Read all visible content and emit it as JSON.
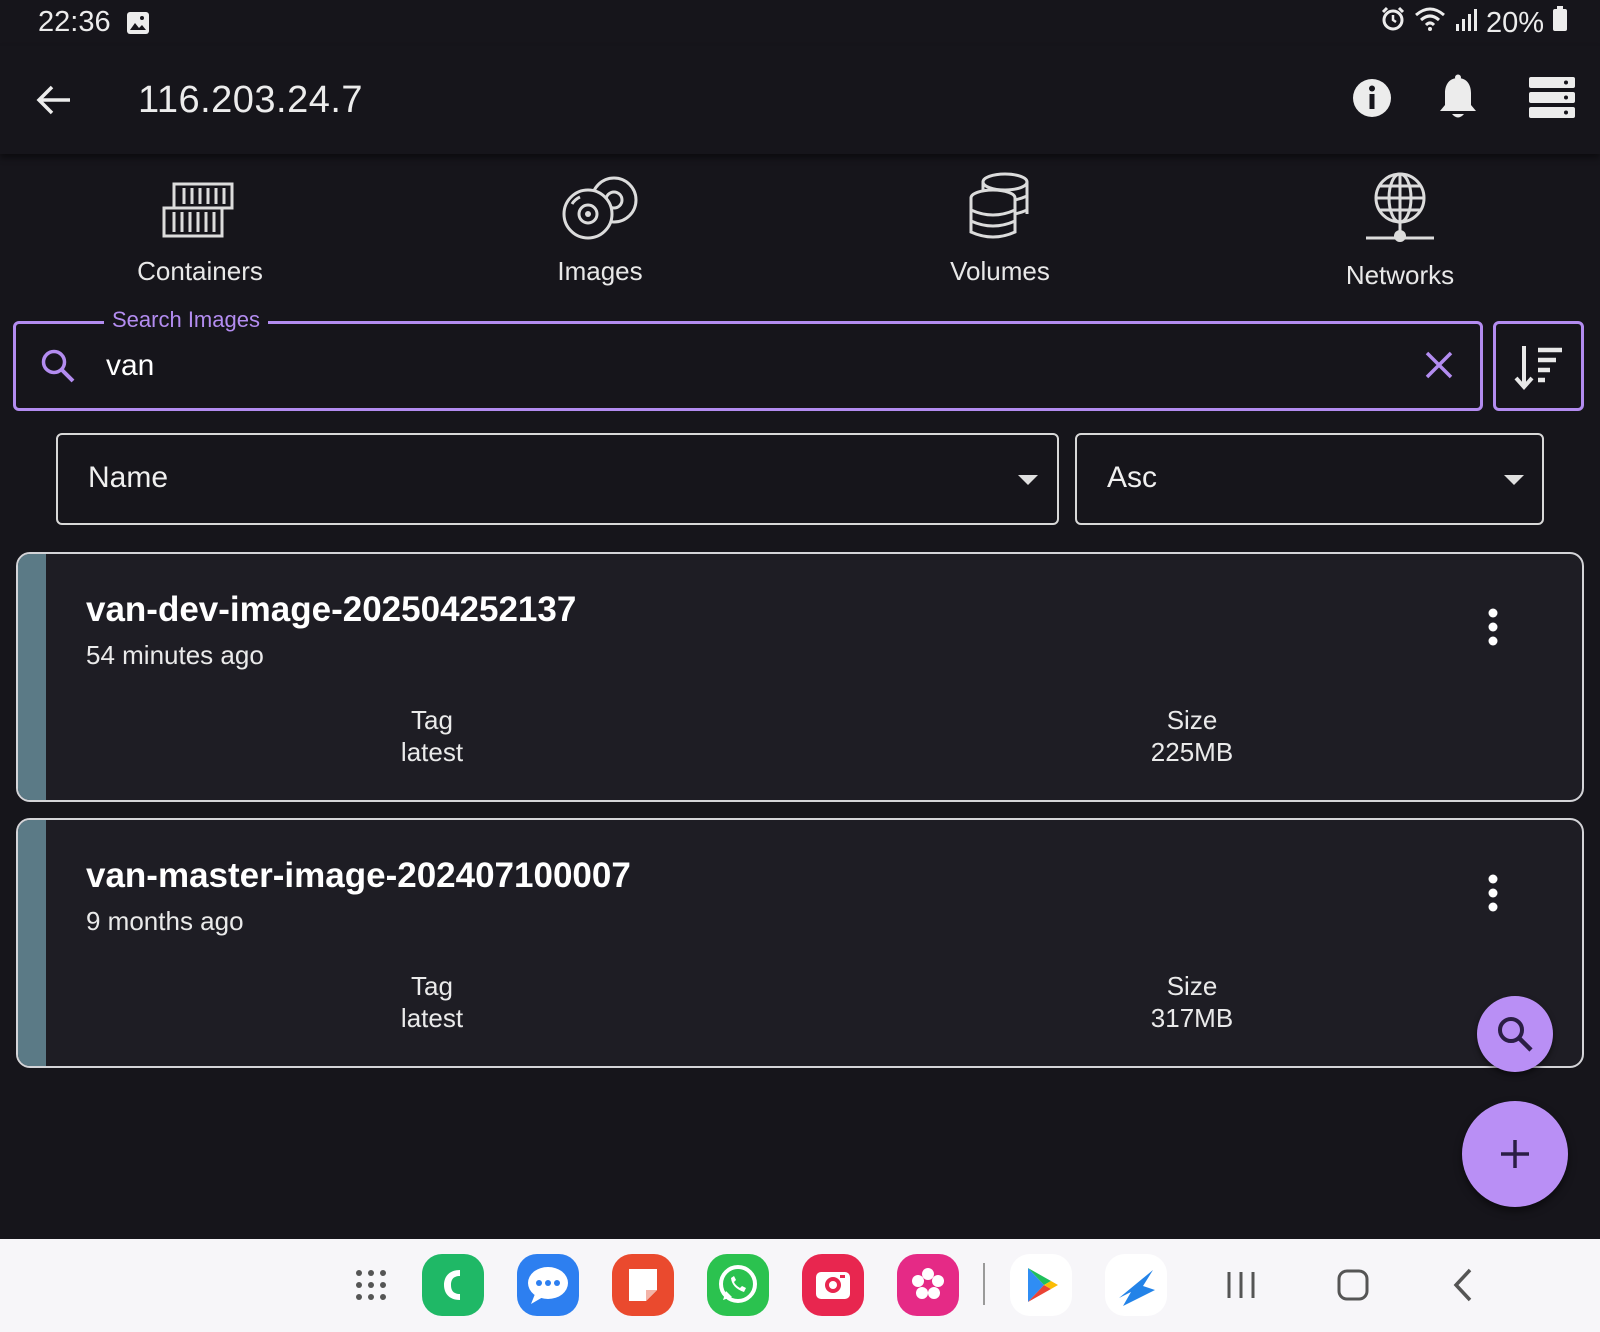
{
  "status_bar": {
    "time": "22:36",
    "battery": "20%",
    "icons": [
      "gallery-icon",
      "alarm-icon",
      "wifi-icon",
      "signal-icon",
      "battery-icon"
    ]
  },
  "app_bar": {
    "title": "116.203.24.7",
    "icons": [
      "back-arrow-icon",
      "info-icon",
      "bell-icon",
      "server-icon"
    ]
  },
  "tabs": [
    {
      "label": "Containers",
      "icon": "containers-icon"
    },
    {
      "label": "Images",
      "icon": "images-icon"
    },
    {
      "label": "Volumes",
      "icon": "volumes-icon"
    },
    {
      "label": "Networks",
      "icon": "networks-icon"
    }
  ],
  "search": {
    "legend": "Search Images",
    "value": "van"
  },
  "sort": {
    "field": "Name",
    "order": "Asc"
  },
  "images": [
    {
      "name": "van-dev-image-202504252137",
      "age": "54 minutes ago",
      "tag_label": "Tag",
      "tag": "latest",
      "size_label": "Size",
      "size": "225MB"
    },
    {
      "name": "van-master-image-202407100007",
      "age": "9 months ago",
      "tag_label": "Tag",
      "tag": "latest",
      "size_label": "Size",
      "size": "317MB"
    }
  ],
  "colors": {
    "background": "#16151b",
    "accent": "#b38cf0",
    "fab": "#b98ff5",
    "card_stripe": "#5b7a86",
    "card_background": "#1e1d24"
  },
  "dock": [
    "apps-grid-icon",
    "phone-icon",
    "messages-icon",
    "notes-icon",
    "whatsapp-icon",
    "camera-icon",
    "flower-gallery-icon",
    "play-store-icon",
    "forward-app-icon",
    "recents-nav-icon",
    "home-nav-icon",
    "back-nav-icon"
  ]
}
